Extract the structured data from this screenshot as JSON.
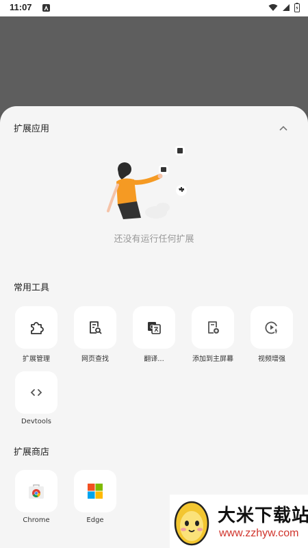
{
  "status_bar": {
    "time": "11:07"
  },
  "extensions_section": {
    "title": "扩展应用",
    "empty_text": "还没有运行任何扩展"
  },
  "tools_section": {
    "title": "常用工具",
    "items": [
      {
        "label": "扩展管理",
        "icon": "puzzle-icon"
      },
      {
        "label": "网页查找",
        "icon": "page-search-icon"
      },
      {
        "label": "翻译...",
        "icon": "translate-icon"
      },
      {
        "label": "添加到主屏幕",
        "icon": "add-to-home-icon"
      },
      {
        "label": "视频增强",
        "icon": "video-enhance-icon"
      },
      {
        "label": "Devtools",
        "icon": "code-icon"
      }
    ]
  },
  "store_section": {
    "title": "扩展商店",
    "items": [
      {
        "label": "Chrome",
        "icon": "chrome-store-icon"
      },
      {
        "label": "Edge",
        "icon": "windows-logo-icon"
      }
    ]
  },
  "watermark": {
    "title": "大米下载站",
    "url": "www.zzhyw.com"
  }
}
